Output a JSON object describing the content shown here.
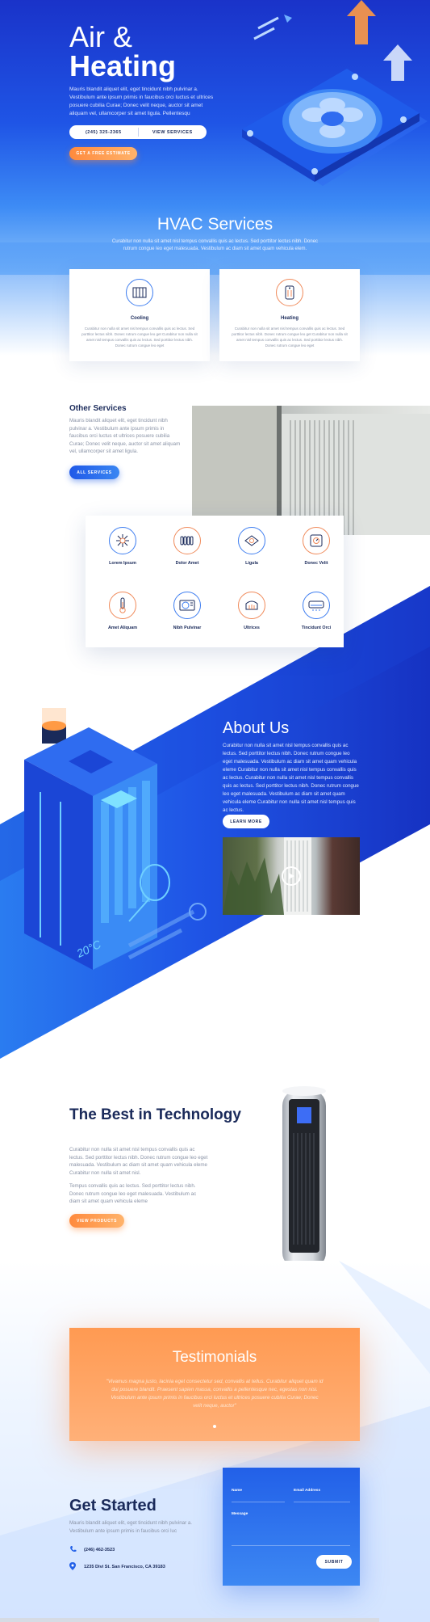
{
  "colors": {
    "primary_blue": "#1f55e6",
    "accent_orange": "#ff9a52",
    "navy": "#1a2a5a"
  },
  "hero": {
    "title_line1": "Air &",
    "title_line2": "Heating",
    "text": "Mauris blandit aliquet elit, eget tincidunt nibh pulvinar a. Vestibulum ante ipsum primis in faucibus orci luctus et ultrices posuere cubilia Curae; Donec velit neque, auctor sit amet aliquam vel, ullamcorper sit amet ligula. Pellentesqu",
    "phone_button": "(245) 325-2365",
    "services_button": "VIEW SERVICES",
    "estimate_button": "GET A FREE ESTIMATE"
  },
  "services": {
    "title": "HVAC Services",
    "subtitle": "Curabitur non nulla sit amet nisl tempus convallis quis ac lectus. Sed porttitor lectus nibh. Donec rutrum congue leo eget malesuada. Vestibulum ac diam sit amet quam vehicula elem.",
    "cards": [
      {
        "icon": "radiator-icon",
        "title": "Cooling",
        "text": "Curabitur non nulla sit amet nisl tempus convallis quis ac lectus. Sed porttitor lectus nibh. Donec rutrum congue leo get Curabitur non nulla sit amet nisl tempus convallis quis ac lectus. Sed porttitor lectus nibh. Donec rutrum congue leo eget"
      },
      {
        "icon": "heater-icon",
        "title": "Heating",
        "text": "Curabitur non nulla sit amet nisl tempus convallis quis ac lectus. Sed porttitor lectus nibh. Donec rutrum congue leo get Curabitur non nulla sit amet nisl tempus convallis quis ac lectus. Sed porttitor lectus nibh. Donec rutrum congue leo eget"
      }
    ]
  },
  "other_services": {
    "title": "Other Services",
    "text": "Mauris blandit aliquet elit, eget tincidunt nibh pulvinar a. Vestibulum ante ipsum primis in faucibus orci luctus et ultrices posuere cubilia Curae; Donec velit neque, auctor sit amet aliquam vel, ullamcorper sit amet ligula.",
    "button": "ALL SERVICES",
    "items": [
      {
        "label": "Lorem Ipsum",
        "icon": "snowflake-icon"
      },
      {
        "label": "Dolor Amet",
        "icon": "radiator-icon"
      },
      {
        "label": "Ligula",
        "icon": "ceiling-fan-icon"
      },
      {
        "label": "Donec Velit",
        "icon": "thermostat-icon"
      },
      {
        "label": "Amet Aliquam",
        "icon": "thermometer-icon"
      },
      {
        "label": "Nibh Pulvinar",
        "icon": "ac-unit-icon"
      },
      {
        "label": "Ultrices",
        "icon": "heater-vent-icon"
      },
      {
        "label": "Tincidunt Orci",
        "icon": "split-ac-icon"
      }
    ]
  },
  "about": {
    "title": "About Us",
    "text": "Curabitur non nulla sit amet nisl tempus convallis quis ac lectus. Sed porttitor lectus nibh. Donec rutrum congue leo eget malesuada. Vestibulum ac diam sit amet quam vehicula eleme Curabitur non nulla sit amet nisl tempus convallis quis ac lectus. Curabitur non nulla sit amet nisl tempus convallis quis ac lectus. Sed porttitor lectus nibh. Donec rutrum congue leo eget malesuada. Vestibulum ac diam sit amet quam vehicula eleme Curabitur non nulla sit amet nisl tempus quis ac lectus.",
    "button": "LEARN MORE",
    "illustration_label": "20°C"
  },
  "tech": {
    "title": "The Best in Technology",
    "p1": "Curabitur non nulla sit amet nisl tempus convallis quis ac lectus. Sed porttitor lectus nibh. Donec rutrum congue leo eget malesuada. Vestibulum ac diam sit amet quam vehicula eleme Curabitur non nulla sit amet nisl.",
    "p2": "Tempus convallis quis ac lectus. Sed porttitor lectus nibh. Donec rutrum congue leo eget malesuada. Vestibulum ac diam sit amet quam vehicula eleme",
    "button": "VIEW PRODUCTS"
  },
  "testimonials": {
    "title": "Testimonials",
    "quote": "\"Vivamus magna justo, lacinia eget consectetur sed, convallis at tellus. Curabitur aliquet quam id dui posuere blandit. Praesent sapien massa, convallis a pellentesque nec, egestas non nisi. Vestibulum ante ipsum primis in faucibus orci luctus et ultrices posuere cubilia Curae; Donec velit neque, auctor\""
  },
  "get_started": {
    "title": "Get Started",
    "text": "Mauris blandit aliquet elit, eget tincidunt nibh pulvinar a. Vestibulum ante ipsum primis in faucibus orci luc",
    "phone": "(246) 462-3523",
    "address": "1235 Divi St. San Francisco, CA 39183",
    "form": {
      "name_label": "Name",
      "email_label": "Email Address",
      "message_label": "Message",
      "submit": "SUBMIT"
    }
  }
}
